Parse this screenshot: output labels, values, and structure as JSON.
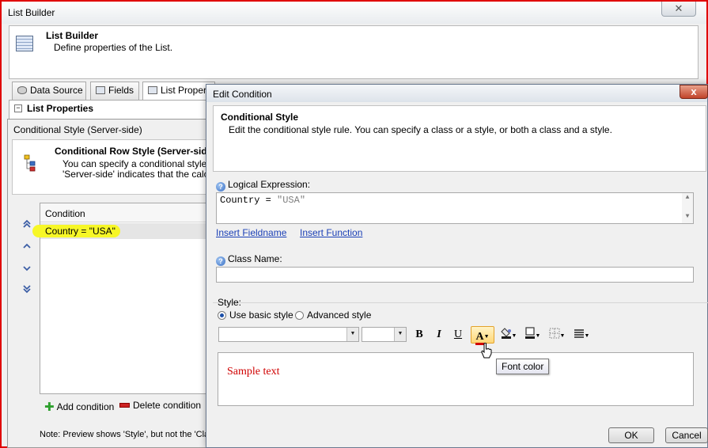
{
  "colors": {
    "accent_red": "#e00000",
    "highlight": "#f7f727",
    "link": "#1a3fb6",
    "preview_text": "#d00000"
  },
  "list_builder": {
    "title": "List Builder",
    "close_glyph": "✕",
    "header": {
      "title": "List Builder",
      "description": "Define properties of the List."
    },
    "tabs": [
      {
        "label": "Data Source",
        "icon": "database-icon"
      },
      {
        "label": "Fields",
        "icon": "fields-icon"
      },
      {
        "label": "List Propert",
        "icon": "list-properties-icon"
      }
    ],
    "section": {
      "toggle": "−",
      "title": "List Properties"
    }
  },
  "conditional_style": {
    "title": "Conditional Style (Server-side)",
    "header": {
      "title": "Conditional Row Style (Server-side",
      "description_line1": "You can specify a conditional style each",
      "description_line2": "'Server-side' indicates that the calculati"
    },
    "move_buttons": {
      "top": "⏶",
      "up": "▲",
      "down": "▼",
      "bottom": "⏷"
    },
    "grid": {
      "column": "Condition",
      "rows": [
        {
          "condition": "Country = \"USA\""
        }
      ]
    },
    "add_condition": "Add condition",
    "delete_condition": "Delete condition",
    "note": "Note: Preview shows 'Style', but not the 'Cla"
  },
  "edit_condition": {
    "title": "Edit Condition",
    "close_glyph": "x",
    "header": {
      "title": "Conditional Style",
      "description": "Edit the conditional style rule. You can specify a class or a style, or both a class and a style."
    },
    "logical_expression_label": "Logical Expression:",
    "expression": {
      "left": "Country = ",
      "right": "\"USA\""
    },
    "insert_fieldname": "Insert Fieldname",
    "insert_function": "Insert Function",
    "class_name_label": "Class Name:",
    "class_name_value": "",
    "style_label": "Style:",
    "basic_style": "Use basic style",
    "advanced_style": "Advanced style",
    "selected_style_mode": "basic",
    "toolbar": {
      "bold": "B",
      "italic": "I",
      "underline": "U",
      "font_color": "A"
    },
    "preview_text": "Sample text",
    "tooltip": "Font color",
    "ok": "OK",
    "cancel": "Cancel"
  }
}
